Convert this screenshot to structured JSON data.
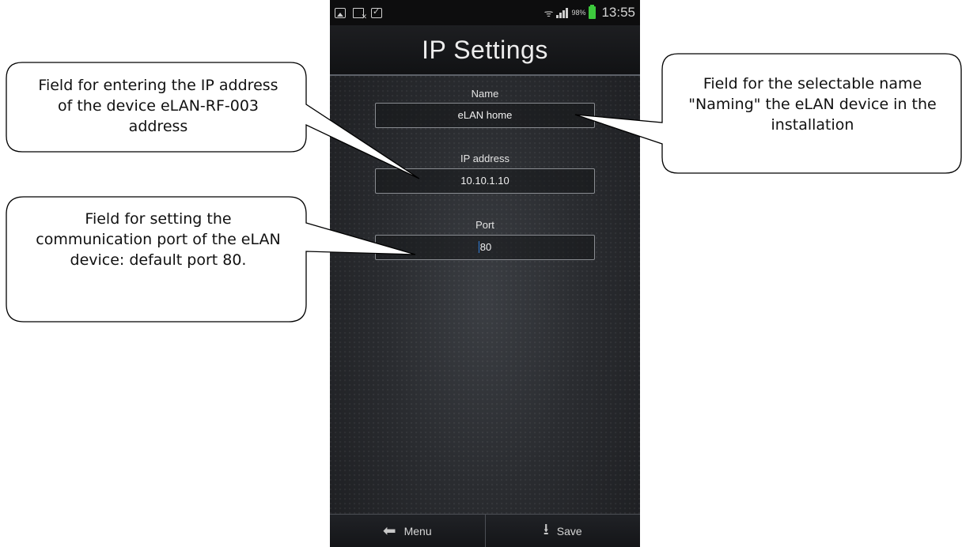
{
  "status_bar": {
    "battery_percent": "98%",
    "time": "13:55",
    "left_icons": [
      "gallery-icon",
      "document-icon",
      "shopping-bag-icon"
    ],
    "right_icons": [
      "wifi-icon",
      "signal-icon",
      "battery-icon"
    ]
  },
  "screen": {
    "title": "IP Settings",
    "fields": {
      "name": {
        "label": "Name",
        "value": "eLAN home"
      },
      "ip": {
        "label": "IP address",
        "value": "10.10.1.10"
      },
      "port": {
        "label": "Port",
        "value": "80"
      }
    },
    "bottom_bar": {
      "menu_label": "Menu",
      "save_label": "Save",
      "menu_icon": "back-arrow-icon",
      "save_icon": "download-icon"
    }
  },
  "callouts": {
    "ip_field": "Field for entering the IP address of the device eLAN-RF-003 address",
    "port_field": "Field for setting the communication port of the eLAN device: default port 80.",
    "name_field": "Field for the selectable name \"Naming\" the eLAN device in the installation"
  },
  "colors": {
    "screen_background": "#2a2c30",
    "status_bar": "#0d0d0e",
    "battery": "#3dc93d",
    "text": "#ededed",
    "callout_border": "#000000"
  }
}
